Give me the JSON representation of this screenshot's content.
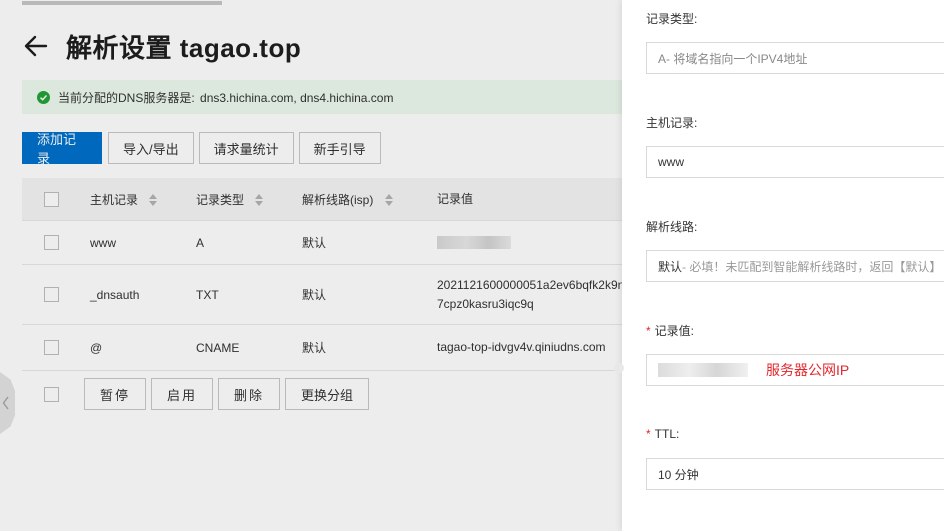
{
  "page": {
    "title": "解析设置 tagao.top"
  },
  "notice": {
    "label": "当前分配的DNS服务器是:",
    "servers": "dns3.hichina.com, dns4.hichina.com"
  },
  "toolbar": {
    "add_record": "添加记录",
    "import_export": "导入/导出",
    "request_stats": "请求量统计",
    "newbie_guide": "新手引导"
  },
  "table": {
    "headers": {
      "host": "主机记录",
      "type": "记录类型",
      "line": "解析线路(isp)",
      "value": "记录值"
    },
    "rows": [
      {
        "host": "www",
        "type": "A",
        "line": "默认",
        "value_line1": "",
        "value_line2": ""
      },
      {
        "host": "_dnsauth",
        "type": "TXT",
        "line": "默认",
        "value_line1": "2021121600000051a2ev6bqfk2k9n",
        "value_line2": "7cpz0kasru3iqc9q"
      },
      {
        "host": "@",
        "type": "CNAME",
        "line": "默认",
        "value_line1": "tagao-top-idvgv4v.qiniudns.com",
        "value_line2": ""
      }
    ]
  },
  "bulk_actions": {
    "pause": "暂停",
    "enable": "启用",
    "delete": "删除",
    "change_group": "更换分组"
  },
  "drawer": {
    "record_type": {
      "label": "记录类型:",
      "value": "A- 将域名指向一个IPV4地址"
    },
    "host_record": {
      "label": "主机记录:",
      "value": "www"
    },
    "resolution_line": {
      "label": "解析线路:",
      "value_main": "默认",
      "value_hint": " - 必填！未匹配到智能解析线路时，返回【默认】"
    },
    "record_value": {
      "required_mark": "*",
      "label": "记录值:",
      "annotation": "服务器公网IP"
    },
    "ttl": {
      "required_mark": "*",
      "label": "TTL:",
      "value": "10 分钟"
    }
  },
  "colors": {
    "primary": "#0070cc",
    "notice_bg": "#edf9ee",
    "success": "#22a33a",
    "required": "#e0282e"
  }
}
